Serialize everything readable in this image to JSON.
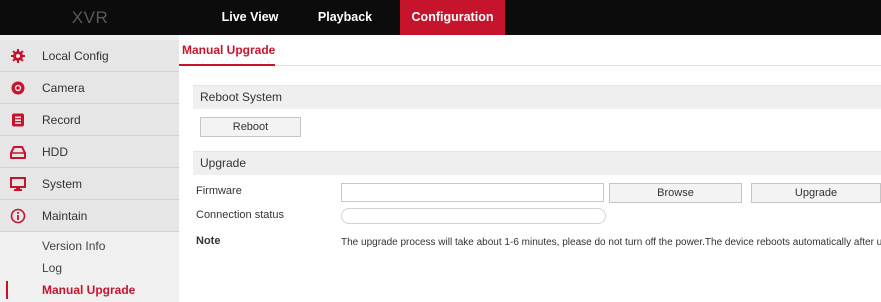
{
  "header": {
    "logo": "XVR",
    "tabs": [
      {
        "label": "Live View",
        "active": false
      },
      {
        "label": "Playback",
        "active": false
      },
      {
        "label": "Configuration",
        "active": true
      }
    ]
  },
  "sidebar": {
    "items": [
      {
        "label": "Local Config",
        "icon": "gear-icon"
      },
      {
        "label": "Camera",
        "icon": "camera-icon"
      },
      {
        "label": "Record",
        "icon": "record-icon"
      },
      {
        "label": "HDD",
        "icon": "hdd-icon"
      },
      {
        "label": "System",
        "icon": "monitor-icon"
      },
      {
        "label": "Maintain",
        "icon": "info-icon"
      }
    ],
    "subitems": [
      {
        "label": "Version Info",
        "active": false
      },
      {
        "label": "Log",
        "active": false
      },
      {
        "label": "Manual Upgrade",
        "active": true
      }
    ]
  },
  "main": {
    "title": "Manual Upgrade",
    "reboot_section": {
      "heading": "Reboot System",
      "button_label": "Reboot"
    },
    "upgrade_section": {
      "heading": "Upgrade",
      "firmware_label": "Firmware",
      "firmware_value": "",
      "browse_label": "Browse",
      "upgrade_label": "Upgrade",
      "connection_label": "Connection status",
      "note_label": "Note",
      "note_text": "The upgrade process will take about 1-6 minutes, please do not turn off the power.The device reboots automatically after upgrading."
    }
  },
  "colors": {
    "accent": "#c7142d",
    "topbar": "#0c0c0c",
    "sidebar": "#e6e6e6"
  }
}
